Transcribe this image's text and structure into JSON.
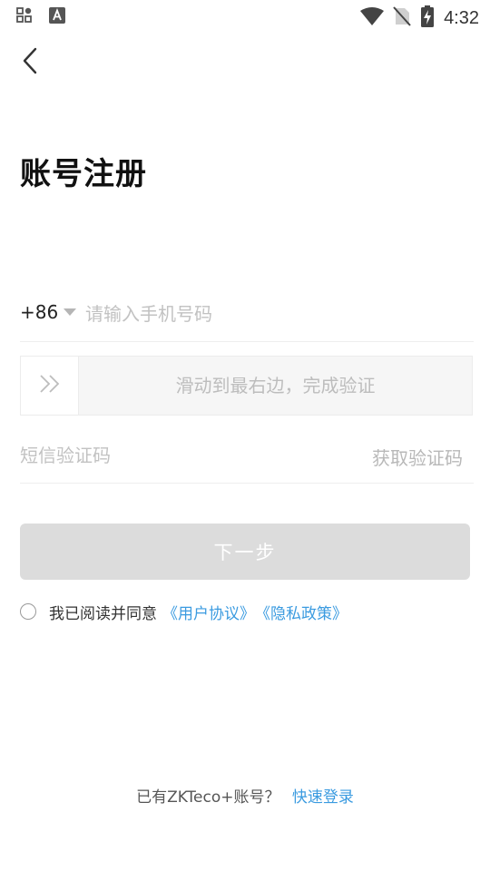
{
  "status_bar": {
    "time": "4:32",
    "left_icons": [
      "apps-icon",
      "font-a-icon"
    ],
    "right_icons": [
      "wifi-icon",
      "no-sim-icon",
      "battery-charging-icon"
    ]
  },
  "header": {
    "back_icon": "chevron-left-icon",
    "title": "账号注册"
  },
  "form": {
    "country_code": "+86",
    "phone_placeholder": "请输入手机号码",
    "slider_text": "滑动到最右边，完成验证",
    "slider_icon": "double-chevron-right-icon",
    "sms_placeholder": "短信验证码",
    "get_code_label": "获取验证码",
    "next_label": "下一步"
  },
  "agreement": {
    "text": "我已阅读并同意",
    "user_agreement": "《用户协议》",
    "privacy_policy": "《隐私政策》"
  },
  "footer": {
    "text": "已有ZKTeco+账号？",
    "login_link": "快速登录"
  },
  "colors": {
    "accent": "#3b9be0",
    "button_disabled": "#dcdcdc",
    "placeholder": "#c2c2c2"
  }
}
